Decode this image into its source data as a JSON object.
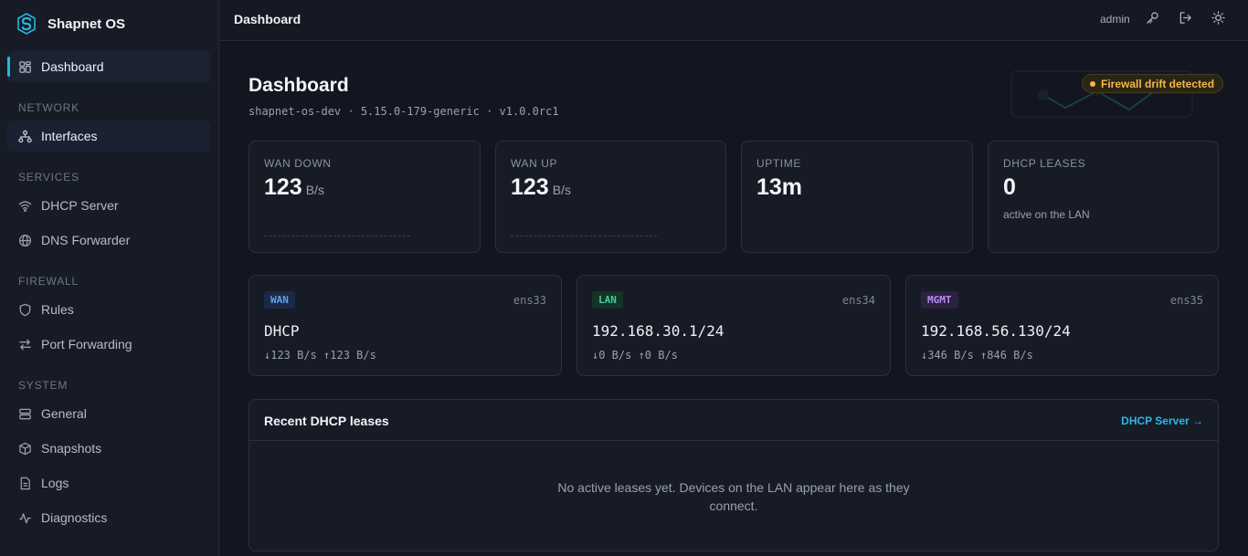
{
  "app": {
    "name": "Shapnet OS"
  },
  "sidebar": {
    "dashboard": "Dashboard",
    "sections": {
      "network": "NETWORK",
      "services": "SERVICES",
      "firewall": "FIREWALL",
      "system": "SYSTEM"
    },
    "items": {
      "interfaces": "Interfaces",
      "dhcp_server": "DHCP Server",
      "dns_forwarder": "DNS Forwarder",
      "rules": "Rules",
      "port_forwarding": "Port Forwarding",
      "general": "General",
      "snapshots": "Snapshots",
      "logs": "Logs",
      "diagnostics": "Diagnostics"
    }
  },
  "topbar": {
    "title": "Dashboard",
    "user": "admin"
  },
  "page": {
    "title": "Dashboard",
    "subtitle": "shapnet-os-dev · 5.15.0-179-generic · v1.0.0rc1",
    "drift_badge": "Firewall drift detected"
  },
  "stats": {
    "wan_down": {
      "label": "WAN DOWN",
      "value": "123",
      "unit": "B/s"
    },
    "wan_up": {
      "label": "WAN UP",
      "value": "123",
      "unit": "B/s"
    },
    "uptime": {
      "label": "UPTIME",
      "value": "13m"
    },
    "dhcp": {
      "label": "DHCP LEASES",
      "value": "0",
      "note": "active on the LAN"
    }
  },
  "interfaces": {
    "wan": {
      "tag": "WAN",
      "device": "ens33",
      "address": "DHCP",
      "rates": "↓123 B/s ↑123 B/s"
    },
    "lan": {
      "tag": "LAN",
      "device": "ens34",
      "address": "192.168.30.1/24",
      "rates": "↓0 B/s ↑0 B/s"
    },
    "mgmt": {
      "tag": "MGMT",
      "device": "ens35",
      "address": "192.168.56.130/24",
      "rates": "↓346 B/s ↑846 B/s"
    }
  },
  "leases": {
    "title": "Recent DHCP leases",
    "link": "DHCP Server →",
    "empty": "No active leases yet. Devices on the LAN appear here as they connect."
  },
  "colors": {
    "accent": "#22b8e0",
    "warning": "#f0b84a",
    "wan_tag": "#5ea2f0",
    "lan_tag": "#3fcf9a",
    "mgmt_tag": "#b98cf0"
  }
}
